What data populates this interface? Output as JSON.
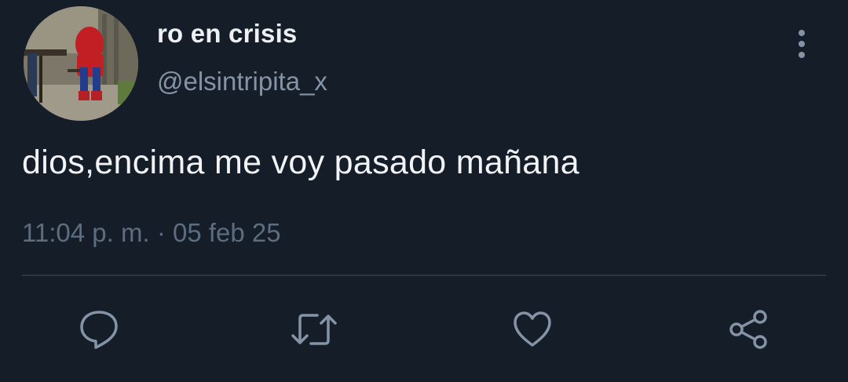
{
  "user": {
    "display_name": "ro en crisis",
    "handle": "@elsintripita_x"
  },
  "tweet": {
    "text": "dios,encima me voy pasado mañana",
    "time": "11:04 p. m.",
    "separator": "·",
    "date": "05 feb 25"
  },
  "actions": {
    "reply_icon": "speech-bubble-icon",
    "retweet_icon": "retweet-arrows-icon",
    "like_icon": "heart-icon",
    "share_icon": "share-nodes-icon"
  },
  "colors": {
    "background": "#151d28",
    "primary_text": "#eef1f4",
    "secondary_text": "#8494a6",
    "meta_text": "#5d6d80",
    "icon": "#8494a6",
    "divider": "#2b3643"
  }
}
